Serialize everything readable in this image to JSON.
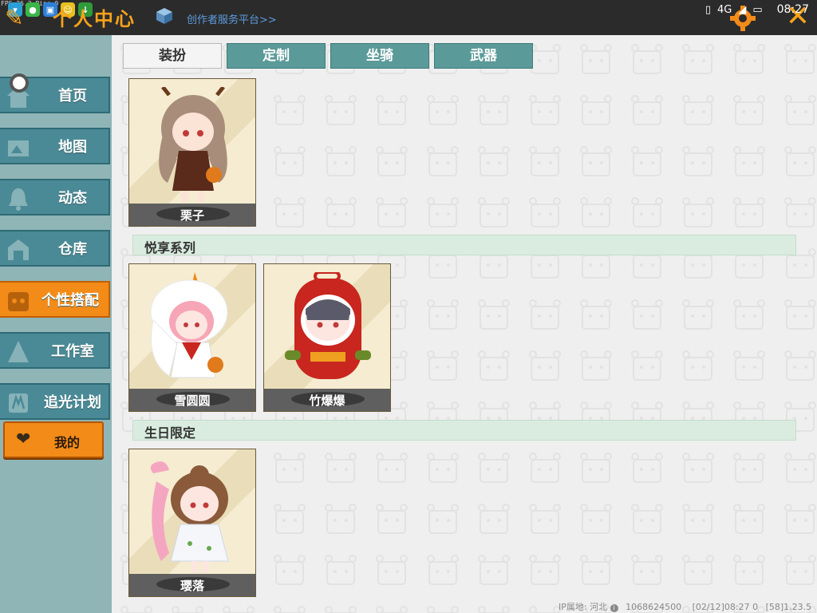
{
  "status_bar": {
    "fps_text": "FPS 36.2 Ping 0",
    "network": "4G",
    "time": "08:27"
  },
  "header": {
    "title": "个人中心",
    "creator_link": "创作者服务平台>>"
  },
  "sidebar": {
    "items": [
      {
        "label": "首页",
        "icon": "home-icon"
      },
      {
        "label": "地图",
        "icon": "map-icon"
      },
      {
        "label": "动态",
        "icon": "bell-icon"
      },
      {
        "label": "仓库",
        "icon": "warehouse-icon"
      },
      {
        "label": "个性搭配",
        "icon": "outfit-icon",
        "active": true
      },
      {
        "label": "工作室",
        "icon": "studio-icon"
      },
      {
        "label": "追光计划",
        "icon": "plan-icon"
      }
    ],
    "mine_label": "我的"
  },
  "tabs": [
    {
      "label": "装扮",
      "active": true
    },
    {
      "label": "定制"
    },
    {
      "label": "坐骑"
    },
    {
      "label": "武器"
    }
  ],
  "sections": {
    "top_card": {
      "name": "栗子"
    },
    "yuexiang": {
      "title": "悦享系列",
      "cards": [
        {
          "name": "雪圆圆"
        },
        {
          "name": "竹爆爆"
        }
      ]
    },
    "birthday": {
      "title": "生日限定",
      "cards": [
        {
          "name": "璎落"
        }
      ]
    }
  },
  "footer": {
    "ip_label": "IP属地: 河北",
    "uid": "1068624500",
    "timestamp": "[02/12]08:27 0",
    "version": "[58]1.23.5"
  },
  "colors": {
    "accent_orange": "#f38b19",
    "nav_teal": "#4a8a96",
    "tab_teal": "#5a9a98",
    "section_green": "#d9ecdf"
  }
}
